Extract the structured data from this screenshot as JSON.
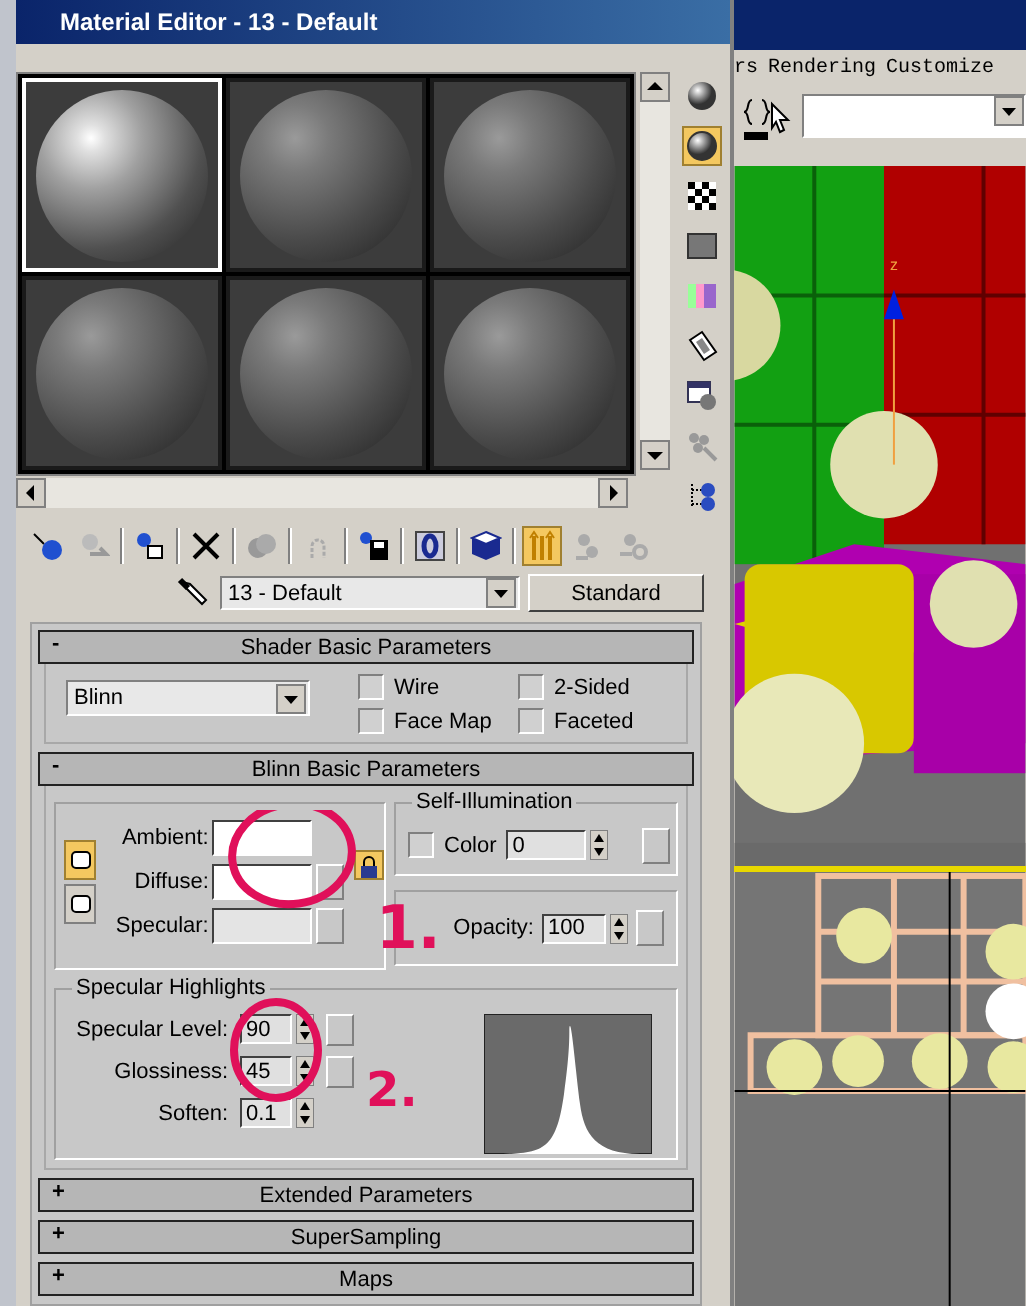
{
  "window": {
    "title": "Material Editor - 13 - Default"
  },
  "sample_slots": [
    {
      "selected": true
    },
    {
      "selected": false
    },
    {
      "selected": false
    },
    {
      "selected": false
    },
    {
      "selected": false
    },
    {
      "selected": false
    }
  ],
  "toggles": {
    "backlight": true,
    "show_end_result": true
  },
  "material": {
    "name": "13 - Default",
    "type": "Standard"
  },
  "shader_basic": {
    "sign": "-",
    "title": "Shader Basic Parameters",
    "expanded": true,
    "shader": "Blinn",
    "options": [
      {
        "label": "Wire",
        "checked": false
      },
      {
        "label": "2-Sided",
        "checked": false
      },
      {
        "label": "Face Map",
        "checked": false
      },
      {
        "label": "Faceted",
        "checked": false
      }
    ]
  },
  "blinn_basic": {
    "sign": "-",
    "title": "Blinn Basic Parameters",
    "expanded": true,
    "locked": true,
    "colors": [
      {
        "label": "Ambient:",
        "color": "#ffffff"
      },
      {
        "label": "Diffuse:",
        "color": "#ffffff"
      },
      {
        "label": "Specular:",
        "color": "#e4e4e4"
      }
    ],
    "self_illumination": {
      "title": "Self-Illumination",
      "label": "Color",
      "checked": false,
      "value": "0"
    },
    "opacity": {
      "label": "Opacity:",
      "value": "100"
    },
    "specular_highlights": {
      "title": "Specular Highlights",
      "fields": [
        {
          "label": "Specular Level:",
          "value": "90"
        },
        {
          "label": "Glossiness:",
          "value": "45"
        },
        {
          "label": "Soften:",
          "value": "0.1"
        }
      ]
    }
  },
  "collapsed_rollouts": [
    {
      "sign": "+",
      "title": "Extended Parameters",
      "expanded": false
    },
    {
      "sign": "+",
      "title": "SuperSampling",
      "expanded": false
    },
    {
      "sign": "+",
      "title": "Maps",
      "expanded": false
    }
  ],
  "annotations": [
    {
      "label": "1."
    },
    {
      "label": "2."
    }
  ],
  "main_menu": [
    "rs",
    "Rendering",
    "Customize"
  ],
  "viewport": {
    "axis_label": "z"
  }
}
